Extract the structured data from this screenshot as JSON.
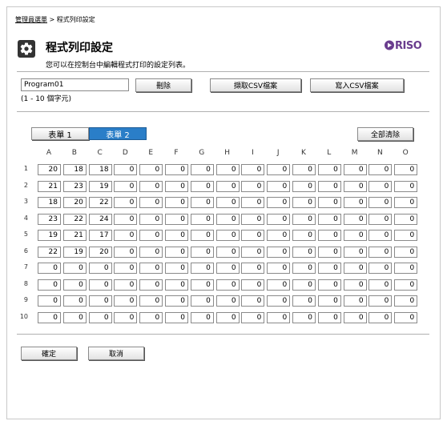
{
  "breadcrumb": {
    "admin_menu": "管理員選單",
    "separator": ">",
    "current": "程式列印設定"
  },
  "page": {
    "title": "程式列印設定",
    "subtitle": "您可以在控制台中編輯程式打印的設定列表。",
    "logo": "RISO"
  },
  "program": {
    "name_value": "Program01",
    "name_hint": "(1 - 10 個字元)"
  },
  "toolbar": {
    "delete_label": "刪除",
    "read_csv_label": "擷取CSV檔案",
    "write_csv_label": "寫入CSV檔案"
  },
  "tabs": [
    {
      "label": "表單 1",
      "active": false
    },
    {
      "label": "表單 2",
      "active": true
    }
  ],
  "clear_all_label": "全部清除",
  "grid": {
    "columns": [
      "A",
      "B",
      "C",
      "D",
      "E",
      "F",
      "G",
      "H",
      "I",
      "J",
      "K",
      "L",
      "M",
      "N",
      "O"
    ],
    "rows": [
      "1",
      "2",
      "3",
      "4",
      "5",
      "6",
      "7",
      "8",
      "9",
      "10"
    ],
    "values": [
      [
        20,
        18,
        18,
        0,
        0,
        0,
        0,
        0,
        0,
        0,
        0,
        0,
        0,
        0,
        0
      ],
      [
        21,
        23,
        19,
        0,
        0,
        0,
        0,
        0,
        0,
        0,
        0,
        0,
        0,
        0,
        0
      ],
      [
        18,
        20,
        22,
        0,
        0,
        0,
        0,
        0,
        0,
        0,
        0,
        0,
        0,
        0,
        0
      ],
      [
        23,
        22,
        24,
        0,
        0,
        0,
        0,
        0,
        0,
        0,
        0,
        0,
        0,
        0,
        0
      ],
      [
        19,
        21,
        17,
        0,
        0,
        0,
        0,
        0,
        0,
        0,
        0,
        0,
        0,
        0,
        0
      ],
      [
        22,
        19,
        20,
        0,
        0,
        0,
        0,
        0,
        0,
        0,
        0,
        0,
        0,
        0,
        0
      ],
      [
        0,
        0,
        0,
        0,
        0,
        0,
        0,
        0,
        0,
        0,
        0,
        0,
        0,
        0,
        0
      ],
      [
        0,
        0,
        0,
        0,
        0,
        0,
        0,
        0,
        0,
        0,
        0,
        0,
        0,
        0,
        0
      ],
      [
        0,
        0,
        0,
        0,
        0,
        0,
        0,
        0,
        0,
        0,
        0,
        0,
        0,
        0,
        0
      ],
      [
        0,
        0,
        0,
        0,
        0,
        0,
        0,
        0,
        0,
        0,
        0,
        0,
        0,
        0,
        0
      ]
    ]
  },
  "footer": {
    "confirm_label": "確定",
    "cancel_label": "取消"
  },
  "colors": {
    "active_tab": "#2a7ec8",
    "logo": "#6a3d8e"
  },
  "icons": {
    "title_icon": "gear-icon",
    "logo_icon": "riso-logo"
  }
}
